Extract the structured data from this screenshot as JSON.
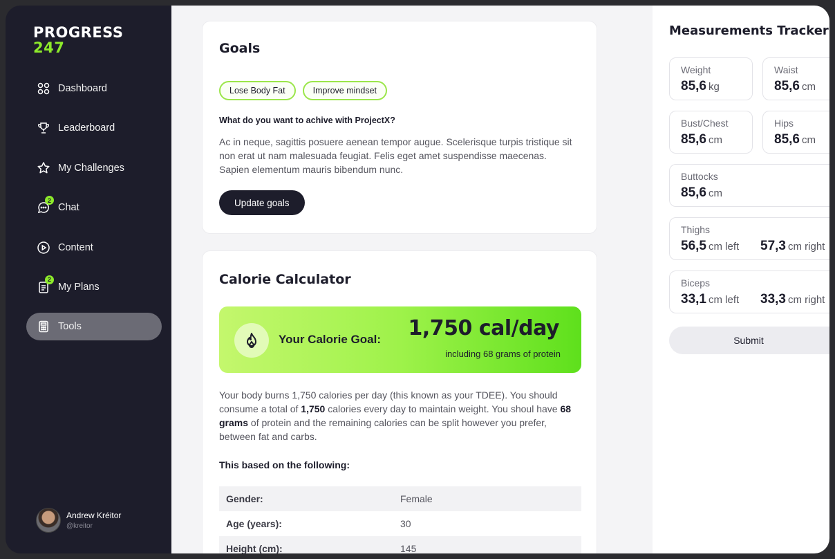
{
  "brand": {
    "line1": "PROGRESS",
    "line2": "247"
  },
  "nav": [
    {
      "label": "Dashboard",
      "icon": "grid-icon"
    },
    {
      "label": "Leaderboard",
      "icon": "trophy-icon"
    },
    {
      "label": "My Challenges",
      "icon": "star-icon"
    },
    {
      "label": "Chat",
      "icon": "chat-icon",
      "badge": "2"
    },
    {
      "label": "Content",
      "icon": "play-icon"
    },
    {
      "label": "My Plans",
      "icon": "document-icon",
      "badge": "2"
    },
    {
      "label": "Tools",
      "icon": "calculator-icon",
      "active": true
    }
  ],
  "user": {
    "name": "Andrew Kréitor",
    "handle": "@kreitor"
  },
  "goals": {
    "title": "Goals",
    "chips": [
      "Lose Body Fat",
      "Improve mindset"
    ],
    "question": "What do you want to achive with ProjectX?",
    "text": "Ac in neque, sagittis posuere aenean tempor augue. Scelerisque turpis tristique sit non erat ut nam malesuada feugiat. Felis eget amet suspendisse maecenas. Sapien elementum mauris bibendum nunc.",
    "button": "Update goals"
  },
  "calculator": {
    "title": "Calorie Calculator",
    "goal_label": "Your Calorie Goal:",
    "goal_value": "1,750 cal/day",
    "goal_sub": "including 68 grams of protein",
    "p1": "Your body burns 1,750 calories per day (this known as your TDEE). You should consume a total of ",
    "p_b1": "1,750",
    "p2": " calories every day to maintain weight. You shoul have ",
    "p_b2": "68 grams",
    "p3": " of protein and the remaining calories can be split however you prefer, between fat and carbs.",
    "based": "This based on the following:",
    "rows": [
      {
        "k": "Gender:",
        "v": "Female"
      },
      {
        "k": "Age (years):",
        "v": "30"
      },
      {
        "k": "Height (cm):",
        "v": "145"
      }
    ]
  },
  "tracker": {
    "title": "Measurements Tracker",
    "weight": {
      "label": "Weight",
      "value": "85,6",
      "unit": "kg"
    },
    "waist": {
      "label": "Waist",
      "value": "85,6",
      "unit": "cm"
    },
    "bust": {
      "label": "Bust/Chest",
      "value": "85,6",
      "unit": "cm"
    },
    "hips": {
      "label": "Hips",
      "value": "85,6",
      "unit": "cm"
    },
    "buttocks": {
      "label": "Buttocks",
      "value": "85,6",
      "unit": "cm"
    },
    "thighs": {
      "label": "Thighs",
      "left": "56,5",
      "left_unit": "cm left",
      "right": "57,3",
      "right_unit": "cm right"
    },
    "biceps": {
      "label": "Biceps",
      "left": "33,1",
      "left_unit": "cm left",
      "right": "33,3",
      "right_unit": "cm right"
    },
    "submit": "Submit"
  },
  "colors": {
    "accent": "#8dea2b",
    "sidebar": "#1d1d2b"
  }
}
